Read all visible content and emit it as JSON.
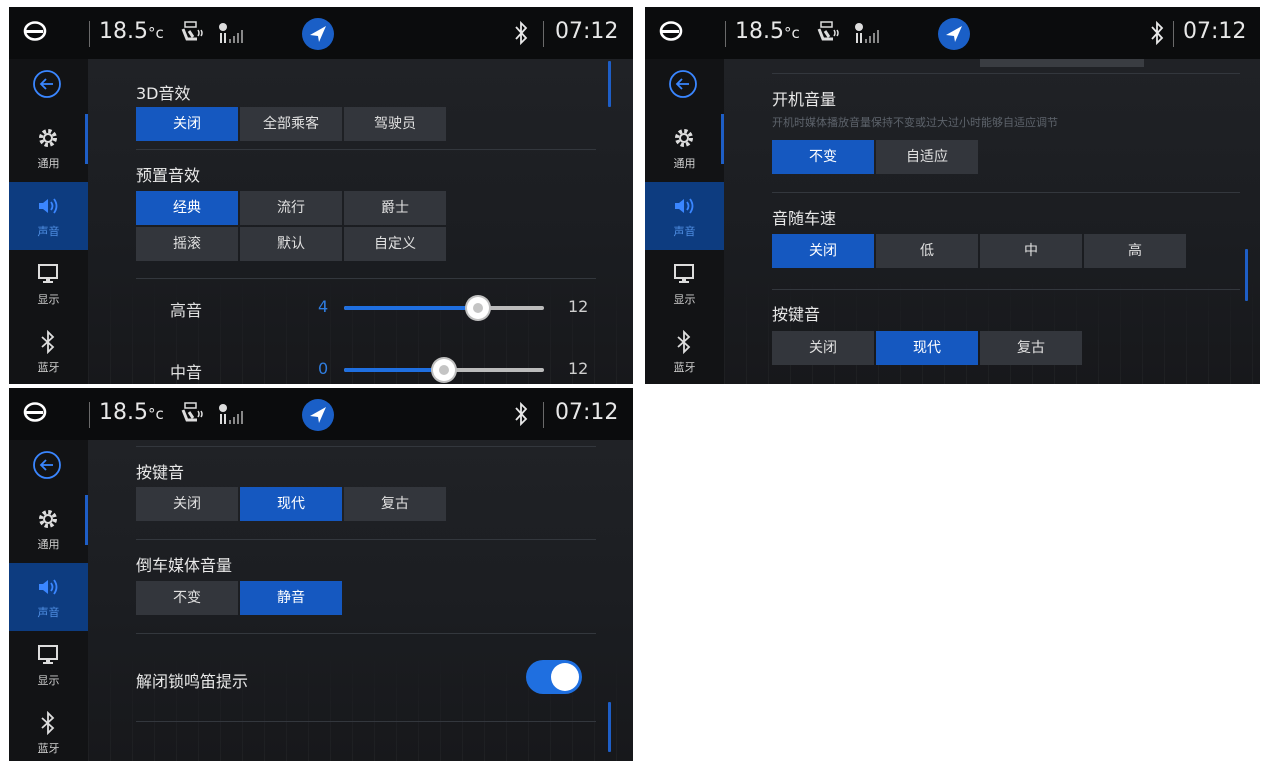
{
  "status_bar": {
    "temperature": "18.5",
    "temperature_unit": "°c",
    "time": "07:12",
    "icons": [
      "brand-logo-icon",
      "seat-heating-icon",
      "fan-speed-icon",
      "navigation-icon",
      "bluetooth-icon"
    ]
  },
  "sidebar": {
    "items": [
      {
        "label": "通用",
        "icon": "gear-icon"
      },
      {
        "label": "声音",
        "icon": "speaker-icon"
      },
      {
        "label": "显示",
        "icon": "monitor-icon"
      },
      {
        "label": "蓝牙",
        "icon": "bluetooth-icon"
      }
    ],
    "active": "声音"
  },
  "panel_a": {
    "effect3d": {
      "title": "3D音效",
      "options": [
        "关闭",
        "全部乘客",
        "驾驶员"
      ],
      "selected": "关闭"
    },
    "preset": {
      "title": "预置音效",
      "options": [
        "经典",
        "流行",
        "爵士",
        "摇滚",
        "默认",
        "自定义"
      ],
      "selected": "经典"
    },
    "treble": {
      "label": "高音",
      "value": "4",
      "max": "12",
      "level_fraction": 0.67
    },
    "mid": {
      "label": "中音",
      "value": "0",
      "max": "12",
      "level_fraction": 0.5
    }
  },
  "panel_b": {
    "startup_volume": {
      "title": "开机音量",
      "desc": "开机时媒体播放音量保持不变或过大过小时能够自适应调节",
      "options": [
        "不变",
        "自适应"
      ],
      "selected": "不变"
    },
    "speed_volume": {
      "title": "音随车速",
      "options": [
        "关闭",
        "低",
        "中",
        "高"
      ],
      "selected": "关闭"
    },
    "key_tone": {
      "title": "按键音",
      "options": [
        "关闭",
        "现代",
        "复古"
      ],
      "selected": "现代"
    }
  },
  "panel_c": {
    "key_tone": {
      "title": "按键音",
      "options": [
        "关闭",
        "现代",
        "复古"
      ],
      "selected": "现代"
    },
    "reverse_media": {
      "title": "倒车媒体音量",
      "options": [
        "不变",
        "静音"
      ],
      "selected": "静音"
    },
    "unlock_horn": {
      "label": "解闭锁鸣笛提示",
      "enabled": true
    }
  },
  "colors": {
    "accent": "#1558c0",
    "background": "#17191c",
    "button": "#33363c"
  }
}
